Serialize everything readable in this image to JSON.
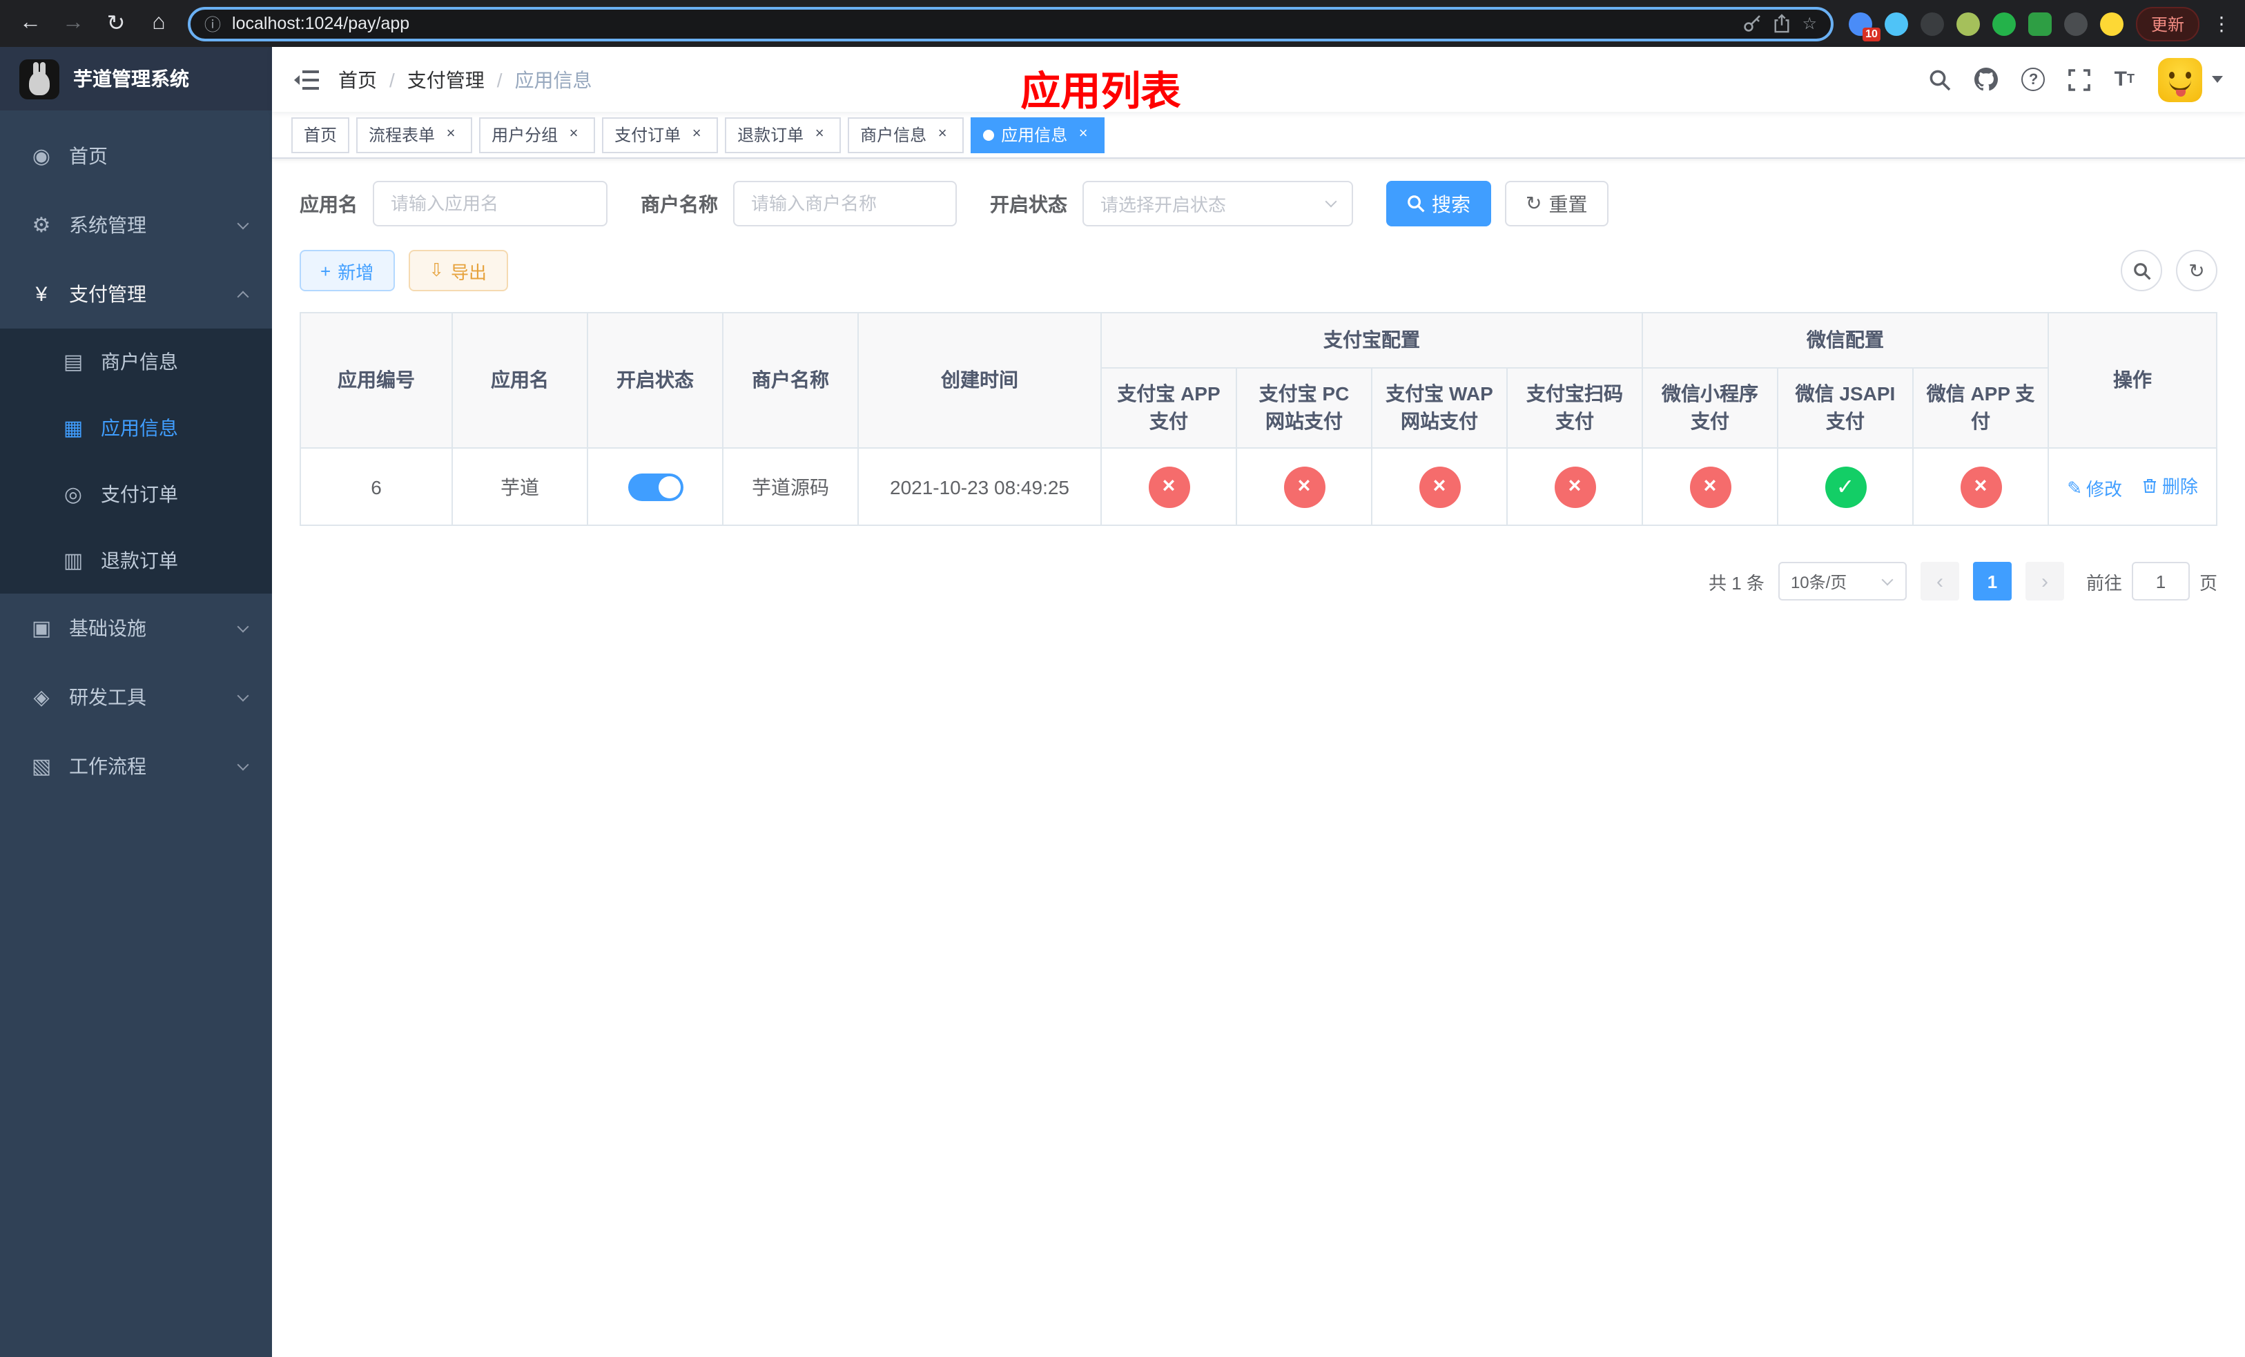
{
  "colors": {
    "accent": "#409eff",
    "success": "#13ce66",
    "danger": "#f56c6c",
    "title_red": "#ff0000",
    "sidebar_bg": "#304156",
    "submenu_bg": "#1f2d3d"
  },
  "icons": {
    "back": "←",
    "forward": "→",
    "reload": "↻",
    "home": "⌂",
    "info": "ⓘ",
    "star": "☆",
    "menu_dots": "⋮",
    "plus": "+",
    "download": "⇩",
    "refresh": "↻",
    "prev": "‹",
    "next": "›",
    "edit": "✎",
    "dashboard": "◉",
    "gear": "⚙",
    "yen": "¥",
    "merchant": "▤",
    "app": "▦",
    "order": "◎",
    "refund": "▥",
    "infra": "▣",
    "devtool": "◈",
    "workflow": "▧"
  },
  "browser": {
    "url": "localhost:1024/pay/app",
    "update_label": "更新",
    "extension_badge": "10"
  },
  "sidebar": {
    "logo_title": "芋道管理系统",
    "menu": [
      {
        "label": "首页"
      },
      {
        "label": "系统管理"
      },
      {
        "label": "支付管理"
      },
      {
        "label": "基础设施"
      },
      {
        "label": "研发工具"
      },
      {
        "label": "工作流程"
      }
    ],
    "payment_submenu": [
      {
        "label": "商户信息"
      },
      {
        "label": "应用信息"
      },
      {
        "label": "支付订单"
      },
      {
        "label": "退款订单"
      }
    ]
  },
  "header": {
    "breadcrumb": [
      {
        "label": "首页"
      },
      {
        "label": "支付管理"
      },
      {
        "label": "应用信息"
      }
    ],
    "page_title": "应用列表"
  },
  "tabs": [
    {
      "label": "首页"
    },
    {
      "label": "流程表单"
    },
    {
      "label": "用户分组"
    },
    {
      "label": "支付订单"
    },
    {
      "label": "退款订单"
    },
    {
      "label": "商户信息"
    },
    {
      "label": "应用信息"
    }
  ],
  "filters": {
    "app_name_label": "应用名",
    "app_name_placeholder": "请输入应用名",
    "merchant_label": "商户名称",
    "merchant_placeholder": "请输入商户名称",
    "status_label": "开启状态",
    "status_placeholder": "请选择开启状态",
    "search_label": "搜索",
    "reset_label": "重置"
  },
  "toolbar": {
    "add_label": "新增",
    "export_label": "导出"
  },
  "table": {
    "columns": {
      "app_id": "应用编号",
      "app_name": "应用名",
      "status": "开启状态",
      "merchant_name": "商户名称",
      "create_time": "创建时间",
      "alipay_group": "支付宝配置",
      "wechat_group": "微信配置",
      "actions": "操作",
      "alipay_app": "支付宝 APP 支付",
      "alipay_pc": "支付宝 PC 网站支付",
      "alipay_wap": "支付宝 WAP 网站支付",
      "alipay_qr": "支付宝扫码支付",
      "wechat_mini": "微信小程序支付",
      "wechat_jsapi": "微信 JSAPI 支付",
      "wechat_app": "微信 APP 支付"
    },
    "row": {
      "app_id": "6",
      "app_name": "芋道",
      "status_on": true,
      "merchant_name": "芋道源码",
      "create_time": "2021-10-23 08:49:25",
      "alipay_app": false,
      "alipay_pc": false,
      "alipay_wap": false,
      "alipay_qr": false,
      "wechat_mini": false,
      "wechat_jsapi": true,
      "wechat_app": false,
      "edit_label": "修改",
      "delete_label": "删除"
    }
  },
  "pagination": {
    "total_label": "共 1 条",
    "page_size_label": "10条/页",
    "current_page": "1",
    "goto_label": "前往",
    "goto_value": "1",
    "page_unit": "页"
  }
}
